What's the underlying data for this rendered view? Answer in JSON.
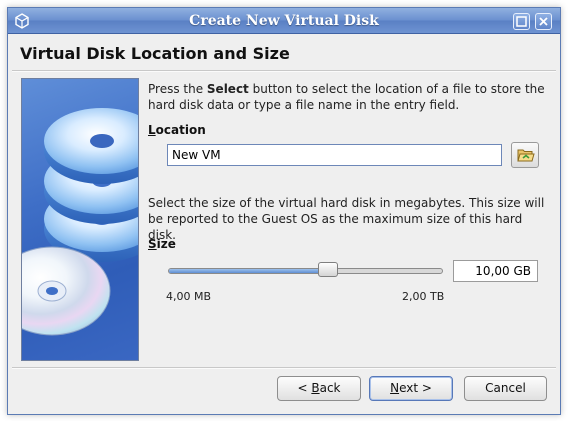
{
  "window": {
    "title": "Create New Virtual Disk",
    "icon": "virtualbox-cube-icon",
    "controls": [
      "maximize-icon",
      "close-icon"
    ]
  },
  "page": {
    "title": "Virtual Disk Location and Size"
  },
  "description1": {
    "before": "Press the ",
    "bold": "Select",
    "after": " button to select the location of a file to store the hard disk data or type a file name in the entry field."
  },
  "location": {
    "label_mnemonic": "L",
    "label_rest": "ocation",
    "value": "New VM",
    "browse_icon": "folder-open-icon"
  },
  "description2": "Select the size of the virtual hard disk in megabytes. This size will be reported to the Guest OS as the maximum size of this hard disk.",
  "size": {
    "label_mnemonic": "S",
    "label_rest": "ize",
    "value": "10,00 GB",
    "slider_min_label": "4,00 MB",
    "slider_max_label": "2,00 TB",
    "slider_position": 0.58
  },
  "buttons": {
    "back_prefix": "< ",
    "back_mnemonic": "B",
    "back_rest": "ack",
    "next_mnemonic": "N",
    "next_rest": "ext >",
    "cancel": "Cancel"
  },
  "colors": {
    "titlebar": "#6a8fcf",
    "accent": "#5f8fd3",
    "side_image": "#3f6fc7"
  }
}
